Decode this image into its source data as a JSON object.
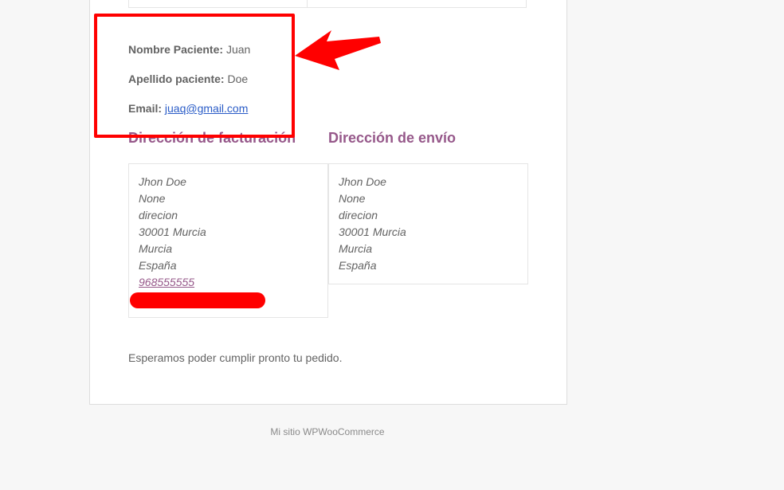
{
  "patient": {
    "nombre_label": "Nombre Paciente:",
    "nombre_value": "Juan",
    "apellido_label": "Apellido paciente:",
    "apellido_value": "Doe",
    "email_label": "Email:",
    "email_value": "juaq@gmail.com"
  },
  "billing": {
    "heading": "Dirección de facturación",
    "lines": [
      "Jhon Doe",
      "None",
      "direcion",
      "30001 Murcia",
      "Murcia",
      "España"
    ],
    "phone": "968555555"
  },
  "shipping": {
    "heading": "Dirección de envío",
    "lines": [
      "Jhon Doe",
      "None",
      "direcion",
      "30001 Murcia",
      "Murcia",
      "España"
    ]
  },
  "closing_text": "Esperamos poder cumplir pronto tu pedido.",
  "footer_text": "Mi sitio WPWooCommerce",
  "colors": {
    "accent": "#96588a",
    "annotation": "#ff0000",
    "link": "#2a5cc7"
  }
}
